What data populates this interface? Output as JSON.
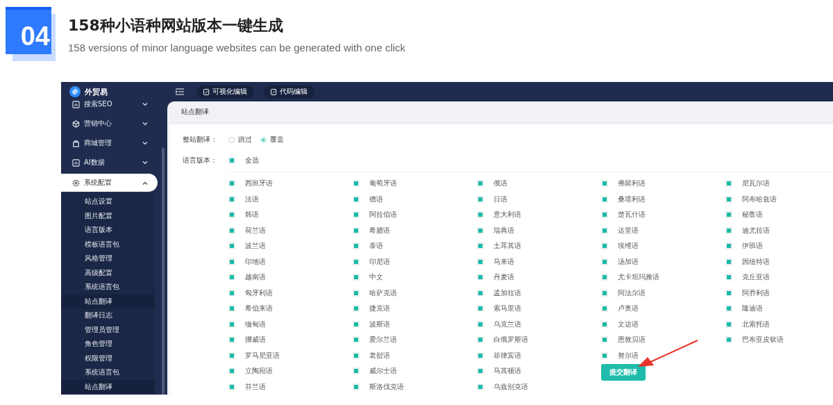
{
  "header": {
    "badge": "04",
    "title": "158种小语种网站版本一键生成",
    "subtitle": "158 versions of minor language websites can be generated with one click"
  },
  "app": {
    "logo": "外贸易",
    "sidebar": [
      {
        "label": "搜索SEO",
        "expanded": false,
        "selected": false
      },
      {
        "label": "营销中心",
        "expanded": false,
        "selected": false
      },
      {
        "label": "商城管理",
        "expanded": false,
        "selected": false
      },
      {
        "label": "AI数据",
        "expanded": false,
        "selected": false
      },
      {
        "label": "系统配置",
        "expanded": true,
        "selected": true,
        "children": [
          {
            "label": "站点设置",
            "selected": false
          },
          {
            "label": "图片配置",
            "selected": false
          },
          {
            "label": "语言版本",
            "selected": false
          },
          {
            "label": "模板语言包",
            "selected": false
          },
          {
            "label": "风格管理",
            "selected": false
          },
          {
            "label": "高级配置",
            "selected": false
          },
          {
            "label": "系统语言包",
            "selected": false
          },
          {
            "label": "站点翻译",
            "selected": true
          },
          {
            "label": "翻译日志",
            "selected": false
          },
          {
            "label": "管理员管理",
            "selected": false
          },
          {
            "label": "角色管理",
            "selected": false
          },
          {
            "label": "权限管理",
            "selected": false
          },
          {
            "label": "系统语言包",
            "selected": false
          },
          {
            "label": "站点翻译",
            "selected": true
          }
        ]
      }
    ],
    "toolbar": [
      "可视化编辑",
      "代码编辑"
    ],
    "breadcrumb": "站点翻译",
    "whole_site": {
      "label": "整站翻译：",
      "options": [
        {
          "label": "跳过",
          "selected": false
        },
        {
          "label": "覆盖",
          "selected": true
        }
      ]
    },
    "languages": {
      "label": "语言版本：",
      "select_all": {
        "label": "全选",
        "checked": true
      },
      "columns": [
        {
          "items": [
            {
              "label": "西班牙语",
              "checked": true
            },
            {
              "label": "法语",
              "checked": true
            },
            {
              "label": "韩语",
              "checked": true
            },
            {
              "label": "荷兰语",
              "checked": true
            },
            {
              "label": "波兰语",
              "checked": true
            },
            {
              "label": "印地语",
              "checked": true
            },
            {
              "label": "越南语",
              "checked": true
            },
            {
              "label": "匈牙利语",
              "checked": true
            },
            {
              "label": "希伯来语",
              "checked": true
            },
            {
              "label": "缅甸语",
              "checked": true
            },
            {
              "label": "挪威语",
              "checked": true
            },
            {
              "label": "罗马尼亚语",
              "checked": true
            },
            {
              "label": "立陶宛语",
              "checked": true
            },
            {
              "label": "芬兰语",
              "checked": true
            }
          ]
        },
        {
          "items": [
            {
              "label": "葡萄牙语",
              "checked": true
            },
            {
              "label": "德语",
              "checked": true
            },
            {
              "label": "阿拉伯语",
              "checked": true
            },
            {
              "label": "希腊语",
              "checked": true
            },
            {
              "label": "泰语",
              "checked": true
            },
            {
              "label": "印尼语",
              "checked": true
            },
            {
              "label": "中文",
              "checked": true
            },
            {
              "label": "哈萨克语",
              "checked": true
            },
            {
              "label": "捷克语",
              "checked": true
            },
            {
              "label": "波斯语",
              "checked": true
            },
            {
              "label": "爱尔兰语",
              "checked": true
            },
            {
              "label": "老挝语",
              "checked": true
            },
            {
              "label": "威尔士语",
              "checked": true
            },
            {
              "label": "斯洛伐克语",
              "checked": true
            }
          ]
        },
        {
          "items": [
            {
              "label": "俄语",
              "checked": true
            },
            {
              "label": "日语",
              "checked": true
            },
            {
              "label": "意大利语",
              "checked": true
            },
            {
              "label": "瑞典语",
              "checked": true
            },
            {
              "label": "土耳其语",
              "checked": true
            },
            {
              "label": "马来语",
              "checked": true
            },
            {
              "label": "丹麦语",
              "checked": true
            },
            {
              "label": "孟加拉语",
              "checked": true
            },
            {
              "label": "索马里语",
              "checked": true
            },
            {
              "label": "乌克兰语",
              "checked": true
            },
            {
              "label": "白俄罗斯语",
              "checked": true
            },
            {
              "label": "菲律宾语",
              "checked": true
            },
            {
              "label": "马其顿语",
              "checked": true
            },
            {
              "label": "乌兹别克语",
              "checked": true
            }
          ]
        },
        {
          "items": [
            {
              "label": "弗留利语",
              "checked": true
            },
            {
              "label": "桑塔利语",
              "checked": true
            },
            {
              "label": "楚瓦什语",
              "checked": true
            },
            {
              "label": "达里语",
              "checked": true
            },
            {
              "label": "埃维语",
              "checked": true
            },
            {
              "label": "汤加语",
              "checked": true
            },
            {
              "label": "尤卡坦玛雅语",
              "checked": true
            },
            {
              "label": "阿法尔语",
              "checked": true
            },
            {
              "label": "卢奥语",
              "checked": true
            },
            {
              "label": "文达语",
              "checked": true
            },
            {
              "label": "恩敦贝语",
              "checked": true
            },
            {
              "label": "努尔语",
              "checked": true
            }
          ],
          "button": "提交翻译"
        },
        {
          "items": [
            {
              "label": "尼瓦尔语",
              "checked": true
            },
            {
              "label": "阿布哈兹语",
              "checked": true
            },
            {
              "label": "秘鲁语",
              "checked": true
            },
            {
              "label": "迪尤拉语",
              "checked": true
            },
            {
              "label": "伊班语",
              "checked": true
            },
            {
              "label": "因纽特语",
              "checked": true
            },
            {
              "label": "克丘亚语",
              "checked": true
            },
            {
              "label": "阿乔利语",
              "checked": true
            },
            {
              "label": "隆迪语",
              "checked": true
            },
            {
              "label": "北索托语",
              "checked": true
            },
            {
              "label": "巴布亚皮钦语",
              "checked": true
            }
          ]
        }
      ]
    }
  }
}
